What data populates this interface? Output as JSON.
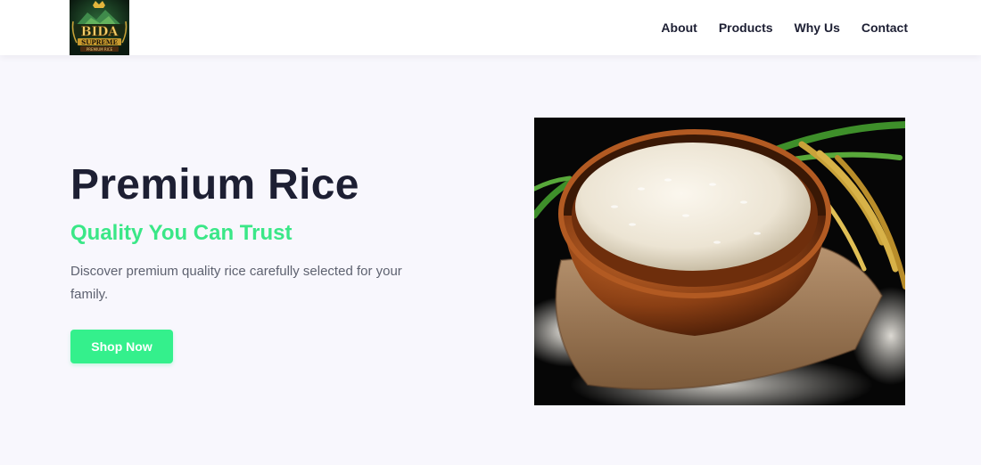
{
  "brand": {
    "logo_line1": "BIDA",
    "logo_line2": "SUPREME",
    "logo_line3": "PREMIUM RICE"
  },
  "nav": {
    "items": [
      {
        "label": "About"
      },
      {
        "label": "Products"
      },
      {
        "label": "Why Us"
      },
      {
        "label": "Contact"
      }
    ]
  },
  "hero": {
    "title": "Premium Rice",
    "subtitle": "Quality You Can Trust",
    "description": "Discover premium quality rice carefully selected for your family.",
    "cta_label": "Shop Now"
  },
  "colors": {
    "accent": "#34f08c",
    "subtitle": "#3ae787",
    "text_dark": "#1d1f33",
    "background": "#f8f7fd"
  }
}
